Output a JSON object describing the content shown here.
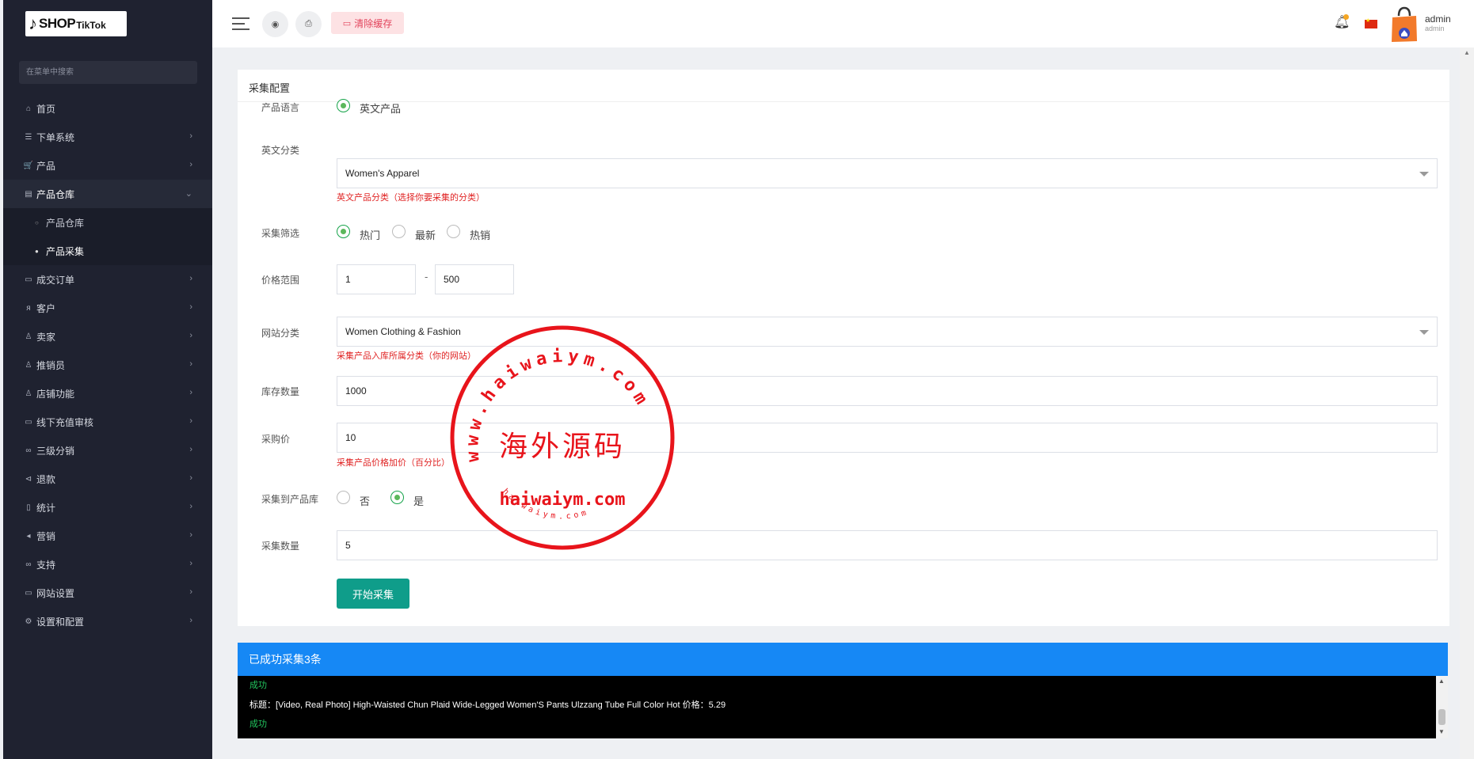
{
  "logo": {
    "note": "♪",
    "text1": "SHOP",
    "text2": "TikTok"
  },
  "sidebar": {
    "search_placeholder": "在菜单中搜索",
    "items": [
      {
        "label": "首页",
        "icon": "home-icon",
        "glyph": "⌂",
        "has_children": false
      },
      {
        "label": "下单系统",
        "icon": "list-icon",
        "glyph": "☰",
        "has_children": true
      },
      {
        "label": "产品",
        "icon": "cart-icon",
        "glyph": "🛒",
        "has_children": true
      },
      {
        "label": "产品仓库",
        "icon": "warehouse-icon",
        "glyph": "▤",
        "has_children": true,
        "open": true
      },
      {
        "label": "成交订单",
        "icon": "order-icon",
        "glyph": "▭",
        "has_children": true
      },
      {
        "label": "客户",
        "icon": "customers-icon",
        "glyph": "ᴙ",
        "has_children": true
      },
      {
        "label": "卖家",
        "icon": "seller-icon",
        "glyph": "♙",
        "has_children": true
      },
      {
        "label": "推销员",
        "icon": "salesman-icon",
        "glyph": "♙",
        "has_children": true
      },
      {
        "label": "店铺功能",
        "icon": "shop-icon",
        "glyph": "♙",
        "has_children": true
      },
      {
        "label": "线下充值审核",
        "icon": "recharge-icon",
        "glyph": "▭",
        "has_children": true
      },
      {
        "label": "三级分销",
        "icon": "link-icon",
        "glyph": "∞",
        "has_children": true
      },
      {
        "label": "退款",
        "icon": "refund-icon",
        "glyph": "⊲",
        "has_children": true
      },
      {
        "label": "统计",
        "icon": "stats-icon",
        "glyph": "▯",
        "has_children": true
      },
      {
        "label": "营销",
        "icon": "megaphone-icon",
        "glyph": "◂",
        "has_children": true
      },
      {
        "label": "支持",
        "icon": "support-icon",
        "glyph": "∞",
        "has_children": true
      },
      {
        "label": "网站设置",
        "icon": "monitor-icon",
        "glyph": "▭",
        "has_children": true
      },
      {
        "label": "设置和配置",
        "icon": "settings-icon",
        "glyph": "⚙",
        "has_children": true
      }
    ],
    "sub_items": [
      {
        "label": "产品仓库",
        "active": false
      },
      {
        "label": "产品采集",
        "active": true
      }
    ]
  },
  "topbar": {
    "clear_cache": "清除缓存",
    "user_name": "admin",
    "user_role": "admin"
  },
  "form": {
    "title": "采集配置",
    "lang_label": "产品语言",
    "lang_option": "英文产品",
    "category_label": "英文分类",
    "category_value": "Women's Apparel",
    "category_hint": "英文产品分类（选择你要采集的分类）",
    "filter_label": "采集筛选",
    "filter_options": [
      "热门",
      "最新",
      "热销"
    ],
    "filter_selected": "热门",
    "price_label": "价格范围",
    "price_min": "1",
    "price_dash": "-",
    "price_max": "500",
    "site_category_label": "网站分类",
    "site_category_value": "Women Clothing & Fashion",
    "site_category_hint": "采集产品入库所属分类（你的网站）",
    "stock_label": "库存数量",
    "stock_value": "1000",
    "purchase_label": "采购价",
    "purchase_value": "10",
    "purchase_hint": "采集产品价格加价（百分比）",
    "to_warehouse_label": "采集到产品库",
    "to_warehouse_options": [
      "否",
      "是"
    ],
    "to_warehouse_selected": "是",
    "count_label": "采集数量",
    "count_value": "5",
    "start_button": "开始采集"
  },
  "result": {
    "header": "已成功采集3条",
    "line1": "成功",
    "line2": "标题：[Video, Real Photo] High-Waisted Chun Plaid Wide-Legged Women'S Pants Ulzzang Tube Full Color Hot  价格：5.29",
    "line3": "成功"
  },
  "watermark": {
    "center_text": "海外源码",
    "middle_text": "haiwaiym.com",
    "ring_text": "www.haiwaiym.com",
    "bottom_text": "haiwaiym.com",
    "color": "#e8141b"
  }
}
